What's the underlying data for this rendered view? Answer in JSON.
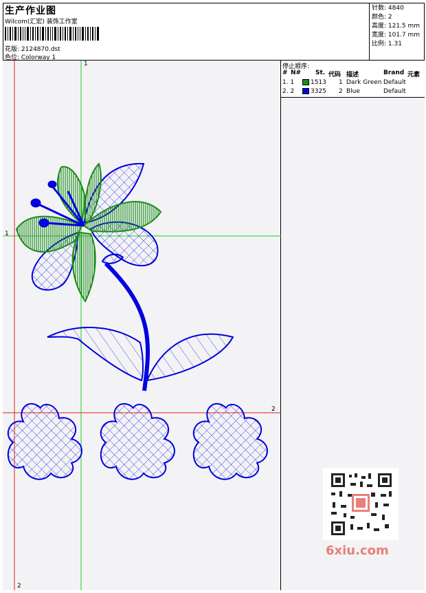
{
  "header": {
    "title": "生产作业图",
    "company": "Wilcom(汇宏) 装饰工作室",
    "design": "花版: 2124870.dst",
    "colorway": "色位: Colorway 1"
  },
  "stats": {
    "stitches": "针数: 4840",
    "colors": "颜色: 2",
    "height": "高度: 121.5 mm",
    "width": "宽度: 101.7 mm",
    "scale": "比例: 1.31"
  },
  "stop_sequence": {
    "title": "停止顺序:",
    "columns": [
      "#",
      "N#",
      "St.",
      "代码",
      "描述",
      "Brand",
      "元素"
    ],
    "rows": [
      {
        "idx": "1. 1",
        "color": "#1a8c1a",
        "stitches": "1513",
        "code": "1",
        "desc": "Dark Green",
        "brand": "Default"
      },
      {
        "idx": "2. 2",
        "color": "#0000e0",
        "stitches": "3325",
        "code": "2",
        "desc": "Blue",
        "brand": "Default"
      }
    ]
  },
  "axes": {
    "h1": "1",
    "v1": "1",
    "h2": "2",
    "v2": "2"
  },
  "watermark": "6xiu.com",
  "colors": {
    "green": "#1a8c1a",
    "blue": "#0000e0",
    "guide_green": "#22cc22",
    "guide_red": "#dd2222"
  }
}
